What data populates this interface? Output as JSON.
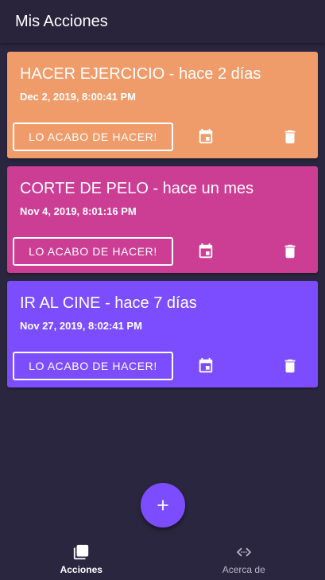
{
  "appbar": {
    "title": "Mis Acciones"
  },
  "cards": [
    {
      "title": "HACER EJERCICIO - hace 2 días",
      "date": "Dec 2, 2019, 8:00:41 PM",
      "button": "LO ACABO DE HACER!",
      "color": "#ef9c6a"
    },
    {
      "title": "CORTE DE PELO - hace un mes",
      "date": "Nov 4, 2019, 8:01:16 PM",
      "button": "LO ACABO DE HACER!",
      "color": "#cc3d94"
    },
    {
      "title": "IR AL CINE - hace 7 días",
      "date": "Nov 27, 2019, 8:02:41 PM",
      "button": "LO ACABO DE HACER!",
      "color": "#7c4dff"
    }
  ],
  "icons": {
    "calendar": "calendar-icon",
    "delete": "trash-icon",
    "add": "plus-icon"
  },
  "nav": {
    "items": [
      {
        "label": "Acciones",
        "icon": "library-icon",
        "active": true
      },
      {
        "label": "Acerca de",
        "icon": "code-icon",
        "active": false
      }
    ]
  },
  "colors": {
    "background": "#2b2640",
    "accent": "#7c4dff"
  }
}
